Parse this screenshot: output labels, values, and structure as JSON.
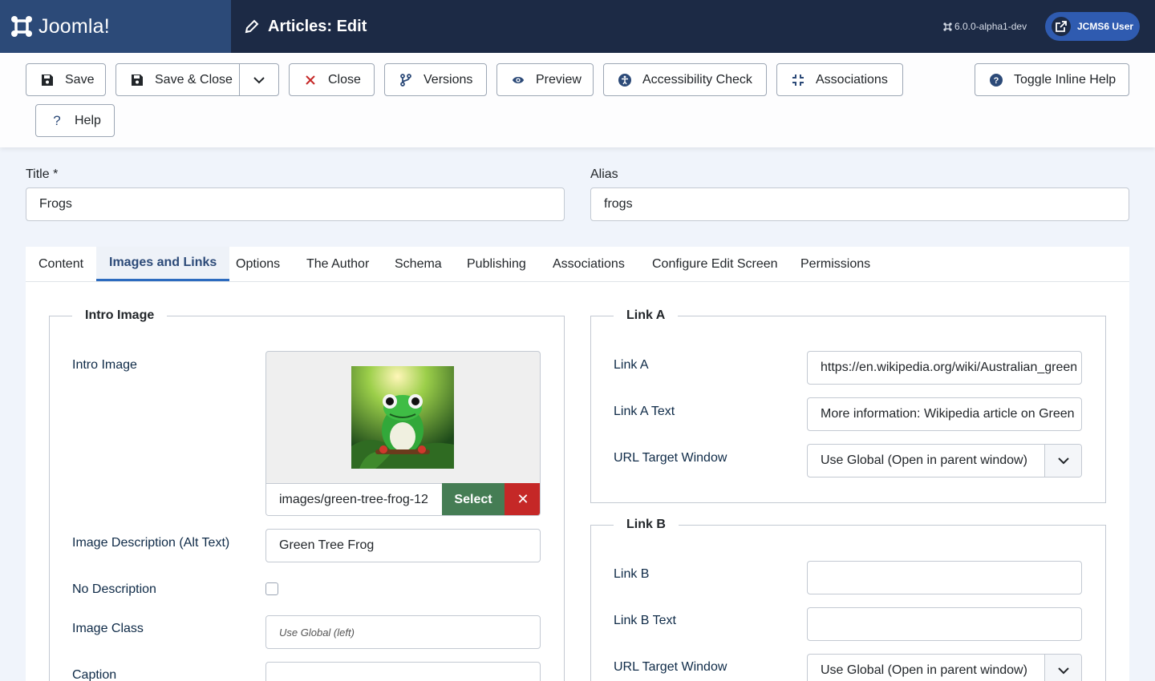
{
  "header": {
    "brand": "Joomla!",
    "page_title": "Articles: Edit",
    "version": "6.0.0-alpha1-dev",
    "user_button": "JCMS6 User"
  },
  "toolbar": {
    "save": "Save",
    "save_close": "Save & Close",
    "close": "Close",
    "versions": "Versions",
    "preview": "Preview",
    "accessibility_check": "Accessibility Check",
    "associations": "Associations",
    "toggle_inline_help": "Toggle Inline Help",
    "help": "Help"
  },
  "form": {
    "title_label": "Title *",
    "title_value": "Frogs",
    "alias_label": "Alias",
    "alias_value": "frogs"
  },
  "tabs": [
    "Content",
    "Images and Links",
    "Options",
    "The Author",
    "Schema",
    "Publishing",
    "Associations",
    "Configure Edit Screen",
    "Permissions"
  ],
  "intro_image": {
    "legend": "Intro Image",
    "image_label": "Intro Image",
    "image_path": "images/green-tree-frog-12",
    "select_label": "Select",
    "clear_label": "✕",
    "alt_label": "Image Description (Alt Text)",
    "alt_value": "Green Tree Frog",
    "no_description_label": "No Description",
    "image_class_label": "Image Class",
    "image_class_placeholder": "Use Global (left)",
    "caption_label": "Caption"
  },
  "link_a": {
    "legend": "Link A",
    "link_label": "Link A",
    "link_value": "https://en.wikipedia.org/wiki/Australian_green_tree_frog",
    "text_label": "Link A Text",
    "text_value": "More information: Wikipedia article on Green Tree Frog",
    "target_label": "URL Target Window",
    "target_value": "Use Global (Open in parent window)"
  },
  "link_b": {
    "legend": "Link B",
    "link_label": "Link B",
    "link_value": "",
    "text_label": "Link B Text",
    "text_value": "",
    "target_label": "URL Target Window",
    "target_value": "Use Global (Open in parent window)"
  },
  "colors": {
    "header_bg": "#1c2a45",
    "logo_bg": "#2c4a78",
    "select_green": "#457d54",
    "clear_red": "#c52827"
  }
}
